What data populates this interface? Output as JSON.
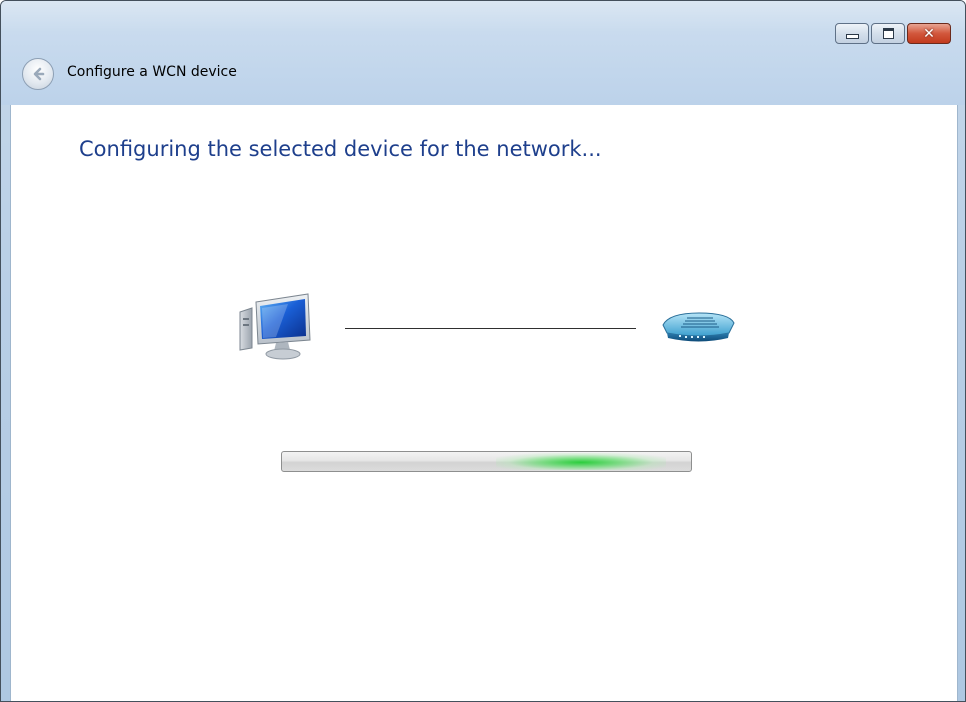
{
  "window": {
    "title": "Configure a WCN device",
    "caption_buttons": {
      "minimize": "minimize",
      "maximize": "maximize",
      "close": "✕"
    }
  },
  "page": {
    "heading": "Configuring the selected device for the network..."
  },
  "graphic": {
    "left_icon": "computer-icon",
    "right_icon": "router-icon"
  },
  "progress": {
    "style": "marquee",
    "glow_position_fraction": 0.73
  },
  "colors": {
    "heading": "#1e3f8c",
    "progress_glow": "#22cd34",
    "close_button": "#c23a1d"
  }
}
